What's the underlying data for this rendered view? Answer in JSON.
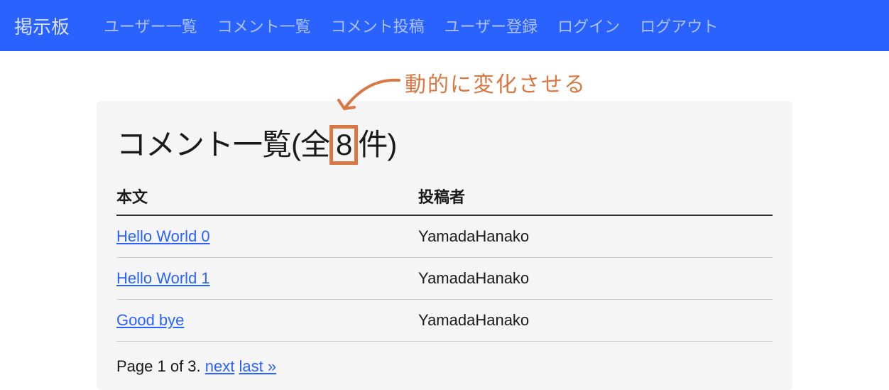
{
  "navbar": {
    "brand": "掲示板",
    "links": [
      "ユーザー一覧",
      "コメント一覧",
      "コメント投稿",
      "ユーザー登録",
      "ログイン",
      "ログアウト"
    ]
  },
  "annotation_text": "動的に変化させる",
  "heading": {
    "prefix": "コメント一覧(全",
    "count": "8",
    "suffix": "件)"
  },
  "table": {
    "headers": [
      "本文",
      "投稿者"
    ],
    "rows": [
      {
        "title": "Hello World 0",
        "author": "YamadaHanako"
      },
      {
        "title": "Hello World 1",
        "author": "YamadaHanako"
      },
      {
        "title": "Good bye",
        "author": "YamadaHanako"
      }
    ]
  },
  "pager": {
    "text_prefix": "Page 1 of 3. ",
    "next": "next",
    "last": "last »"
  }
}
